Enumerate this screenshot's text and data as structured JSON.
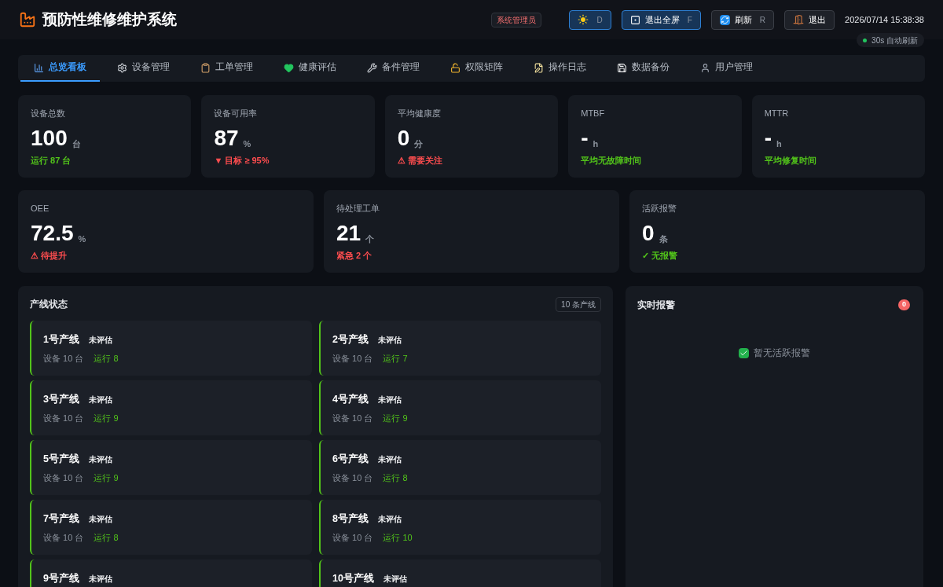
{
  "header": {
    "title": "预防性维修维护系统",
    "role": "系统管理员",
    "buttons": [
      {
        "key": "D",
        "active": true
      },
      {
        "label": "退出全屏",
        "key": "F",
        "active": true
      },
      {
        "label": "刷新",
        "key": "R",
        "active": false
      },
      {
        "label": "退出",
        "active": false
      }
    ],
    "clock": "2026/07/14 15:38:38",
    "auto_refresh": "30s 自动刷新"
  },
  "tabs": [
    {
      "label": "总览看板",
      "selected": true
    },
    {
      "label": "设备管理",
      "selected": false
    },
    {
      "label": "工单管理",
      "selected": false
    },
    {
      "label": "健康评估",
      "selected": false
    },
    {
      "label": "备件管理",
      "selected": false
    },
    {
      "label": "权限矩阵",
      "selected": false
    },
    {
      "label": "操作日志",
      "selected": false
    },
    {
      "label": "数据备份",
      "selected": false
    },
    {
      "label": "用户管理",
      "selected": false
    }
  ],
  "stats_row_1": [
    {
      "label": "设备总数",
      "value": "100",
      "unit": "台",
      "note": "运行 87 台",
      "color": "#52c41a"
    },
    {
      "label": "设备可用率",
      "value": "87",
      "unit": "%",
      "note": "▼ 目标 ≥ 95%",
      "color": "#ff4d4f"
    },
    {
      "label": "平均健康度",
      "value": "0",
      "unit": "分",
      "note": "⚠ 需要关注",
      "color": "#ff4d4f"
    },
    {
      "label": "MTBF",
      "value": "-",
      "unit": "h",
      "note": "平均无故障时间",
      "color": "#52c41a"
    },
    {
      "label": "MTTR",
      "value": "-",
      "unit": "h",
      "note": "平均修复时间",
      "color": "#52c41a"
    }
  ],
  "stats_row_2": [
    {
      "label": "OEE",
      "value": "72.5",
      "unit": "%",
      "note": "⚠ 待提升",
      "color": "#ff4d4f"
    },
    {
      "label": "待处理工单",
      "value": "21",
      "unit": "个",
      "note": "紧急 2 个",
      "color": "#ff4d4f"
    },
    {
      "label": "活跃报警",
      "value": "0",
      "unit": "条",
      "note": "✓ 无报警",
      "color": "#52c41a"
    }
  ],
  "production_lines": {
    "title": "产线状态",
    "count": "10 条产线",
    "items": [
      {
        "name": "1号产线",
        "status": "未评估",
        "devices": "设备 10 台",
        "running": "运行 8"
      },
      {
        "name": "2号产线",
        "status": "未评估",
        "devices": "设备 10 台",
        "running": "运行 7"
      },
      {
        "name": "3号产线",
        "status": "未评估",
        "devices": "设备 10 台",
        "running": "运行 9"
      },
      {
        "name": "4号产线",
        "status": "未评估",
        "devices": "设备 10 台",
        "running": "运行 9"
      },
      {
        "name": "5号产线",
        "status": "未评估",
        "devices": "设备 10 台",
        "running": "运行 9"
      },
      {
        "name": "6号产线",
        "status": "未评估",
        "devices": "设备 10 台",
        "running": "运行 8"
      },
      {
        "name": "7号产线",
        "status": "未评估",
        "devices": "设备 10 台",
        "running": "运行 8"
      },
      {
        "name": "8号产线",
        "status": "未评估",
        "devices": "设备 10 台",
        "running": "运行 10"
      },
      {
        "name": "9号产线",
        "status": "未评估"
      },
      {
        "name": "10号产线",
        "status": "未评估"
      }
    ]
  },
  "alarms": {
    "title": "实时报警",
    "count": "0",
    "empty": "暂无活跃报警"
  }
}
